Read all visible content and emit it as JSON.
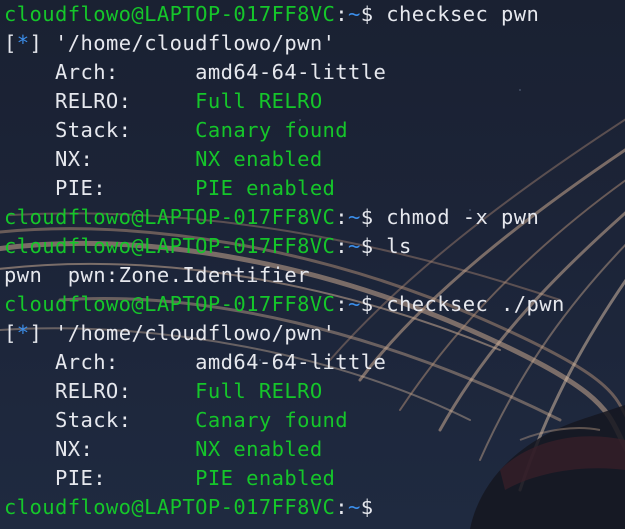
{
  "prompt": {
    "user_host": "cloudflowo@LAPTOP-017FF8VC",
    "colon": ":",
    "path": "~",
    "dollar": "$"
  },
  "block1": {
    "command": "checksec pwn",
    "info_open": "[",
    "info_star": "*",
    "info_close": "]",
    "info_path": "'/home/cloudflowo/pwn'",
    "rows": [
      {
        "key": "Arch:",
        "value": "amd64-64-little",
        "color": "#e6e8ee"
      },
      {
        "key": "RELRO:",
        "value": "Full RELRO",
        "color": "#15c62a"
      },
      {
        "key": "Stack:",
        "value": "Canary found",
        "color": "#15c62a"
      },
      {
        "key": "NX:",
        "value": "NX enabled",
        "color": "#15c62a"
      },
      {
        "key": "PIE:",
        "value": "PIE enabled",
        "color": "#15c62a"
      }
    ]
  },
  "chmod_command": "chmod -x pwn",
  "ls_command": "ls",
  "ls_output": "pwn  pwn:Zone.Identifier",
  "block2": {
    "command": "checksec ./pwn",
    "info_open": "[",
    "info_star": "*",
    "info_close": "]",
    "info_path": "'/home/cloudflowo/pwn'",
    "rows": [
      {
        "key": "Arch:",
        "value": "amd64-64-little",
        "color": "#e6e8ee"
      },
      {
        "key": "RELRO:",
        "value": "Full RELRO",
        "color": "#15c62a"
      },
      {
        "key": "Stack:",
        "value": "Canary found",
        "color": "#15c62a"
      },
      {
        "key": "NX:",
        "value": "NX enabled",
        "color": "#15c62a"
      },
      {
        "key": "PIE:",
        "value": "PIE enabled",
        "color": "#15c62a"
      }
    ]
  },
  "colors": {
    "prompt_green": "#15c62a",
    "path_blue": "#3b8eea",
    "text": "#e6e8ee",
    "background": "#1b2233"
  }
}
